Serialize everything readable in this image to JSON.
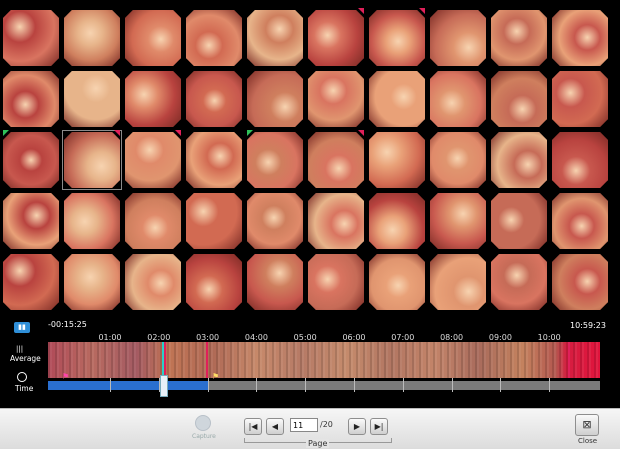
{
  "gallery": {
    "rows": 5,
    "cols": 10,
    "selected_index": 21,
    "palette": [
      "#d97460",
      "#e08a6a",
      "#c8584e",
      "#e9a178",
      "#d26a52",
      "#b9433f",
      "#e0956f",
      "#cf7f5e",
      "#e7b48a",
      "#c66b57"
    ],
    "markers": [
      {
        "index": 5,
        "kind": "red-r"
      },
      {
        "index": 6,
        "kind": "red-r"
      },
      {
        "index": 20,
        "kind": "green"
      },
      {
        "index": 21,
        "kind": "red-r"
      },
      {
        "index": 22,
        "kind": "red-r"
      },
      {
        "index": 24,
        "kind": "green"
      },
      {
        "index": 25,
        "kind": "red-r"
      }
    ]
  },
  "timeline": {
    "camera_icon": "camera-icon",
    "start_time": "-00:15:25",
    "end_time": "10:59:23",
    "ticks": [
      "01:00",
      "02:00",
      "03:00",
      "04:00",
      "05:00",
      "06:00",
      "07:00",
      "08:00",
      "09:00",
      "10:00"
    ],
    "average_label": "Average",
    "time_label": "Time",
    "progress_fraction": 0.29
  },
  "toolbar": {
    "capture_label": "Capture",
    "page_value": "11",
    "page_total": "/20",
    "page_label": "Page",
    "close_label": "Close",
    "first_icon": "skip-first-icon",
    "prev_icon": "prev-icon",
    "next_icon": "next-icon",
    "last_icon": "skip-last-icon"
  },
  "colors": {
    "timeline_progress": "#2a6fd0",
    "cursor_line": "#2ad0c8",
    "marker_green": "#2fc25a",
    "marker_red": "#e0205a"
  }
}
